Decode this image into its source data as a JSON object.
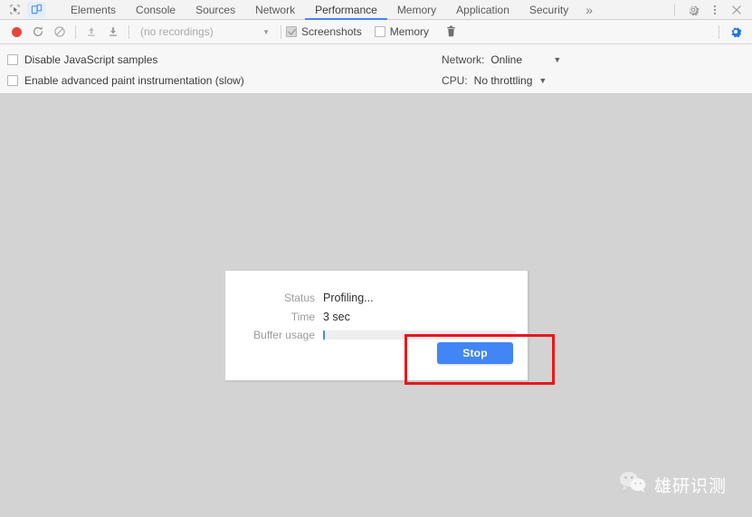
{
  "devtools": {
    "tabs": [
      {
        "label": "Elements",
        "selected": false
      },
      {
        "label": "Console",
        "selected": false
      },
      {
        "label": "Sources",
        "selected": false
      },
      {
        "label": "Network",
        "selected": false
      },
      {
        "label": "Performance",
        "selected": true
      },
      {
        "label": "Memory",
        "selected": false
      },
      {
        "label": "Application",
        "selected": false
      },
      {
        "label": "Security",
        "selected": false
      }
    ],
    "more_label": "»",
    "icons": {
      "inspect": "inspect-element-icon",
      "device": "device-toolbar-icon",
      "settings": "gear-icon",
      "kebab": "more-options-icon",
      "close": "close-icon"
    },
    "accent_color": "#4285f4"
  },
  "controlbar": {
    "record_title": "record-button",
    "reload_title": "reload-and-record-button",
    "clear_title": "clear-recording-button",
    "load_title": "load-profile-button",
    "save_title": "save-profile-button",
    "recordings_value": "(no recordings)",
    "recordings_caret": "▼",
    "screenshots_label": "Screenshots",
    "screenshots_checked": true,
    "memory_label": "Memory",
    "memory_checked": false,
    "trash_title": "collect-garbage-button",
    "settings_title": "capture-settings-button"
  },
  "settings": {
    "disable_js_samples": {
      "label": "Disable JavaScript samples",
      "checked": false
    },
    "advanced_paint": {
      "label": "Enable advanced paint instrumentation (slow)",
      "checked": false
    },
    "network": {
      "label": "Network:",
      "value": "Online",
      "caret": "▼"
    },
    "cpu": {
      "label": "CPU:",
      "value": "No throttling",
      "caret": "▼"
    }
  },
  "modal": {
    "status_label": "Status",
    "status_value": "Profiling...",
    "time_label": "Time",
    "time_value": "3 sec",
    "buffer_label": "Buffer usage",
    "buffer_percent": 1,
    "stop_button": "Stop"
  },
  "highlight": {
    "color": "#f01414",
    "target": "stop-button"
  },
  "watermark": {
    "text": "雄研识测",
    "logo": "wechat-logo-icon"
  }
}
